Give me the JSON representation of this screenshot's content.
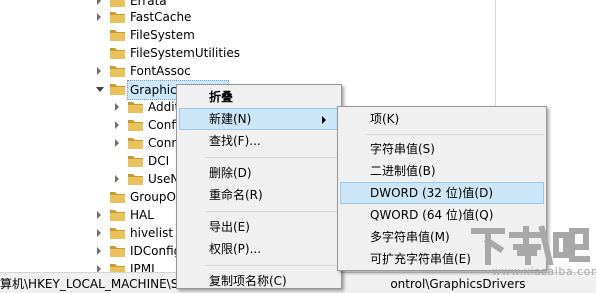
{
  "tree": {
    "nodes": [
      {
        "label": "Errata",
        "expander": "collapsed",
        "selected": false
      },
      {
        "label": "FastCache",
        "expander": "collapsed",
        "selected": false
      },
      {
        "label": "FileSystem",
        "expander": "none",
        "selected": false
      },
      {
        "label": "FileSystemUtilities",
        "expander": "none",
        "selected": false
      },
      {
        "label": "FontAssoc",
        "expander": "collapsed",
        "selected": false
      },
      {
        "label": "GraphicsDrivers",
        "expander": "expanded",
        "selected": true
      },
      {
        "label": "AdditionalModeLists",
        "expander": "collapsed",
        "selected": false
      },
      {
        "label": "Configuration",
        "expander": "collapsed",
        "selected": false
      },
      {
        "label": "Connectivity",
        "expander": "collapsed",
        "selected": false
      },
      {
        "label": "DCI",
        "expander": "none",
        "selected": false
      },
      {
        "label": "UseNewKey",
        "expander": "collapsed",
        "selected": false
      },
      {
        "label": "GroupOrderList",
        "expander": "none",
        "selected": false
      },
      {
        "label": "HAL",
        "expander": "collapsed",
        "selected": false
      },
      {
        "label": "hivelist",
        "expander": "collapsed",
        "selected": false
      },
      {
        "label": "IDConfigDB",
        "expander": "collapsed",
        "selected": false
      },
      {
        "label": "IPMI",
        "expander": "collapsed",
        "selected": false
      }
    ]
  },
  "status_bar": {
    "path_start": "算机\\HKEY_LOCAL_MACHINE\\S",
    "path_end": "ontrol\\GraphicsDrivers"
  },
  "context_menu": {
    "items": [
      {
        "label": "折叠",
        "bold": true
      },
      {
        "label": "新建(N)",
        "hover": true,
        "submenu": true
      },
      {
        "label": "查找(F)..."
      },
      {
        "separator": true
      },
      {
        "label": "删除(D)"
      },
      {
        "label": "重命名(R)"
      },
      {
        "separator": true
      },
      {
        "label": "导出(E)"
      },
      {
        "label": "权限(P)..."
      },
      {
        "separator": true
      },
      {
        "label": "复制项名称(C)"
      }
    ]
  },
  "new_submenu": {
    "items": [
      {
        "label": "项(K)"
      },
      {
        "separator": true
      },
      {
        "label": "字符串值(S)"
      },
      {
        "label": "二进制值(B)"
      },
      {
        "label": "DWORD (32 位)值(D)",
        "hover": true
      },
      {
        "label": "QWORD (64 位)值(Q)"
      },
      {
        "label": "多字符串值(M)"
      },
      {
        "label": "可扩充字符串值(E)"
      }
    ]
  },
  "watermark": {
    "glyphs": "下载吧",
    "url": "www.xiazaiba.com"
  },
  "colors": {
    "folder": "#e8c25a",
    "folder_dark": "#c99a2e",
    "menu_bg": "#f0f0f0",
    "menu_hover": "#cde6f7",
    "menu_hover_border": "#99c9ef",
    "tree_selection": "#cce8ff",
    "watermark": "#a8a8a8"
  },
  "icons": {
    "tree_folder": "folder-icon",
    "expander_collapsed": "chevron-right-icon",
    "expander_expanded": "chevron-down-icon",
    "submenu": "submenu-arrow-icon"
  }
}
